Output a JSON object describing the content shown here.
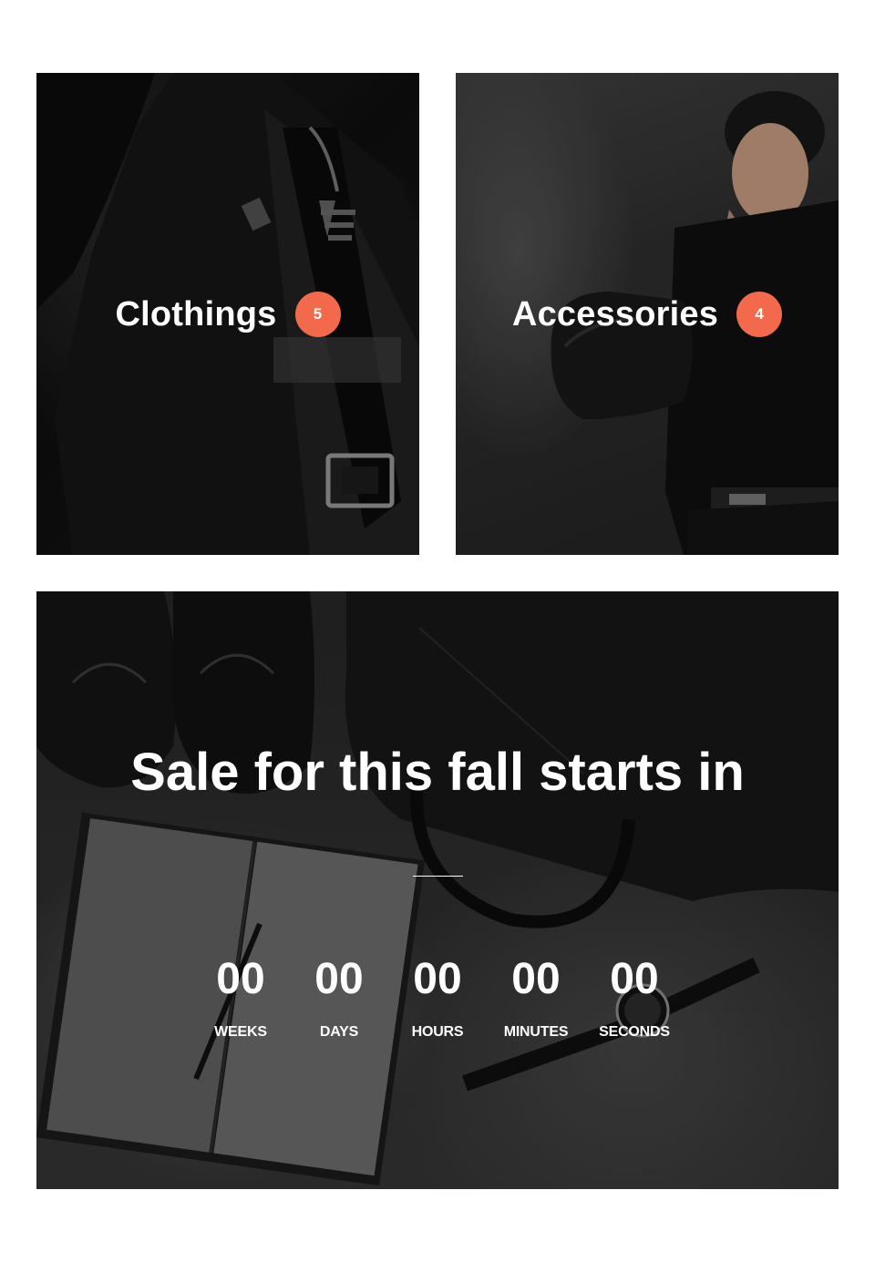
{
  "categories": [
    {
      "name": "Clothings",
      "count": "5"
    },
    {
      "name": "Accessories",
      "count": "4"
    }
  ],
  "sale_banner": {
    "title": "Sale for this fall starts in",
    "countdown": [
      {
        "value": "00",
        "label": "WEEKS"
      },
      {
        "value": "00",
        "label": "DAYS"
      },
      {
        "value": "00",
        "label": "HOURS"
      },
      {
        "value": "00",
        "label": "MINUTES"
      },
      {
        "value": "00",
        "label": "SECONDS"
      }
    ]
  },
  "colors": {
    "badge": "#f26a4b",
    "text": "#ffffff",
    "page_background": "#ffffff"
  }
}
